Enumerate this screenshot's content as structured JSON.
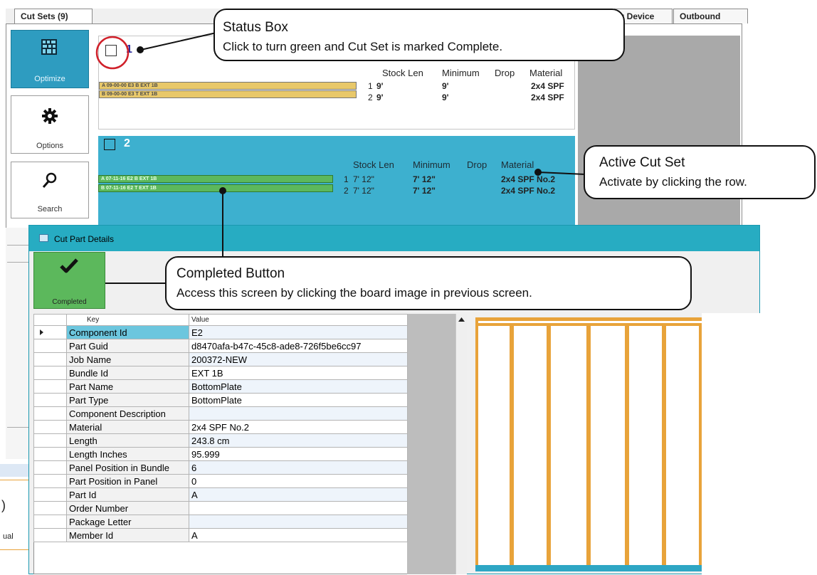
{
  "tabs": {
    "cut_sets": "Cut Sets (9)",
    "device": "g Device",
    "outbound": "Outbound Sorting"
  },
  "toolbar": {
    "optimize": "Optimize",
    "options": "Options",
    "search": "Search"
  },
  "cut_set_1": {
    "number": "1",
    "headers": {
      "stock_len": "Stock Len",
      "minimum": "Minimum",
      "drop": "Drop",
      "material": "Material"
    },
    "boards": [
      "A  09-00-00 E3 B EXT 1B",
      "B  09-00-00 E3 T EXT 1B"
    ],
    "rows": [
      {
        "index": "1",
        "stock_len": "9'",
        "minimum": "9'",
        "material": "2x4 SPF"
      },
      {
        "index": "2",
        "stock_len": "9'",
        "minimum": "9'",
        "material": "2x4 SPF"
      }
    ]
  },
  "cut_set_2": {
    "number": "2",
    "headers": {
      "stock_len": "Stock Len",
      "minimum": "Minimum",
      "drop": "Drop",
      "material": "Material"
    },
    "boards": [
      "A  07-11-16 E2 B EXT 1B",
      "B  07-11-16 E2 T EXT 1B"
    ],
    "rows": [
      {
        "index": "1",
        "stock_len": "7' 12\"",
        "minimum": "7' 12\"",
        "material": "2x4 SPF No.2"
      },
      {
        "index": "2",
        "stock_len": "7' 12\"",
        "minimum": "7' 12\"",
        "material": "2x4 SPF No.2"
      }
    ]
  },
  "left_strip": {
    "ual": "ual",
    "paren": ")"
  },
  "dialog": {
    "title": "Cut Part Details",
    "completed_label": "Completed",
    "grid_headers": {
      "key": "Key",
      "value": "Value"
    },
    "rows": [
      {
        "key": "Component Id",
        "value": "E2"
      },
      {
        "key": "Part Guid",
        "value": "d8470afa-b47c-45c8-ade8-726f5be6cc97"
      },
      {
        "key": "Job Name",
        "value": "200372-NEW"
      },
      {
        "key": "Bundle Id",
        "value": "EXT 1B"
      },
      {
        "key": "Part Name",
        "value": "BottomPlate"
      },
      {
        "key": "Part Type",
        "value": "BottomPlate"
      },
      {
        "key": "Component Description",
        "value": ""
      },
      {
        "key": "Material",
        "value": "2x4 SPF No.2"
      },
      {
        "key": "Length",
        "value": "243.8 cm"
      },
      {
        "key": "Length Inches",
        "value": "95.999"
      },
      {
        "key": "Panel Position in Bundle",
        "value": "6"
      },
      {
        "key": "Part Position in Panel",
        "value": "0"
      },
      {
        "key": "Part Id",
        "value": "A"
      },
      {
        "key": "Order Number",
        "value": ""
      },
      {
        "key": "Package Letter",
        "value": ""
      },
      {
        "key": "Member Id",
        "value": "A"
      }
    ]
  },
  "callouts": {
    "status_title": "Status Box",
    "status_text": "Click to turn green and Cut Set is marked Complete.",
    "active_title": "Active Cut Set",
    "active_text": "Activate by clicking the row.",
    "completed_title": "Completed Button",
    "completed_text": "Access this screen by clicking the board image in previous screen."
  },
  "colors": {
    "accent_teal": "#27acc2",
    "active_row": "#3db0cf",
    "completed_green": "#5cb85c",
    "board_yellow": "#e8c86a",
    "stud_orange": "#e8a33a",
    "highlight_circle": "#d0202a"
  },
  "icons": [
    "optimize-grid-icon",
    "gear-icon",
    "search-icon",
    "checkmark-icon",
    "window-icon",
    "scroll-up-arrow-icon"
  ]
}
